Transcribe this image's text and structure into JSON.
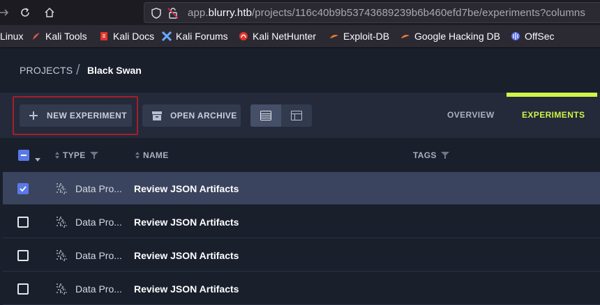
{
  "browser": {
    "url_prefix": "app.",
    "url_host": "blurry.htb",
    "url_path": "/projects/116c40b9b53743689239b6b460efd7be/experiments?columns"
  },
  "bookmarks": [
    {
      "label": "Linux",
      "icon": "kali-icon"
    },
    {
      "label": "Kali Tools",
      "icon": "kali-tools-icon"
    },
    {
      "label": "Kali Docs",
      "icon": "kali-docs-icon"
    },
    {
      "label": "Kali Forums",
      "icon": "kali-forums-icon"
    },
    {
      "label": "Kali NetHunter",
      "icon": "nethunter-icon"
    },
    {
      "label": "Exploit-DB",
      "icon": "exploitdb-icon"
    },
    {
      "label": "Google Hacking DB",
      "icon": "ghdb-icon"
    },
    {
      "label": "OffSec",
      "icon": "offsec-icon"
    }
  ],
  "breadcrumb": {
    "projects": "PROJECTS",
    "separator": "/",
    "current": "Black Swan"
  },
  "toolbar": {
    "new_experiment": "NEW EXPERIMENT",
    "open_archive": "OPEN ARCHIVE",
    "view_modes": [
      "table-view-icon",
      "details-view-icon"
    ],
    "active_view": "table"
  },
  "tabs": {
    "overview": "OVERVIEW",
    "experiments": "EXPERIMENTS",
    "active": "EXPERIMENTS"
  },
  "table": {
    "columns": {
      "type": "TYPE",
      "name": "NAME",
      "tags": "TAGS"
    },
    "rows": [
      {
        "type": "Data Pro...",
        "name": "Review JSON Artifacts",
        "checked": true
      },
      {
        "type": "Data Pro...",
        "name": "Review JSON Artifacts",
        "checked": false
      },
      {
        "type": "Data Pro...",
        "name": "Review JSON Artifacts",
        "checked": false
      },
      {
        "type": "Data Pro...",
        "name": "Review JSON Artifacts",
        "checked": false
      }
    ]
  },
  "colors": {
    "accent": "#d2f34a",
    "checkbox_blue": "#5a79e8",
    "highlight_red": "#a51f2b",
    "selected_row": "#3a445e"
  }
}
